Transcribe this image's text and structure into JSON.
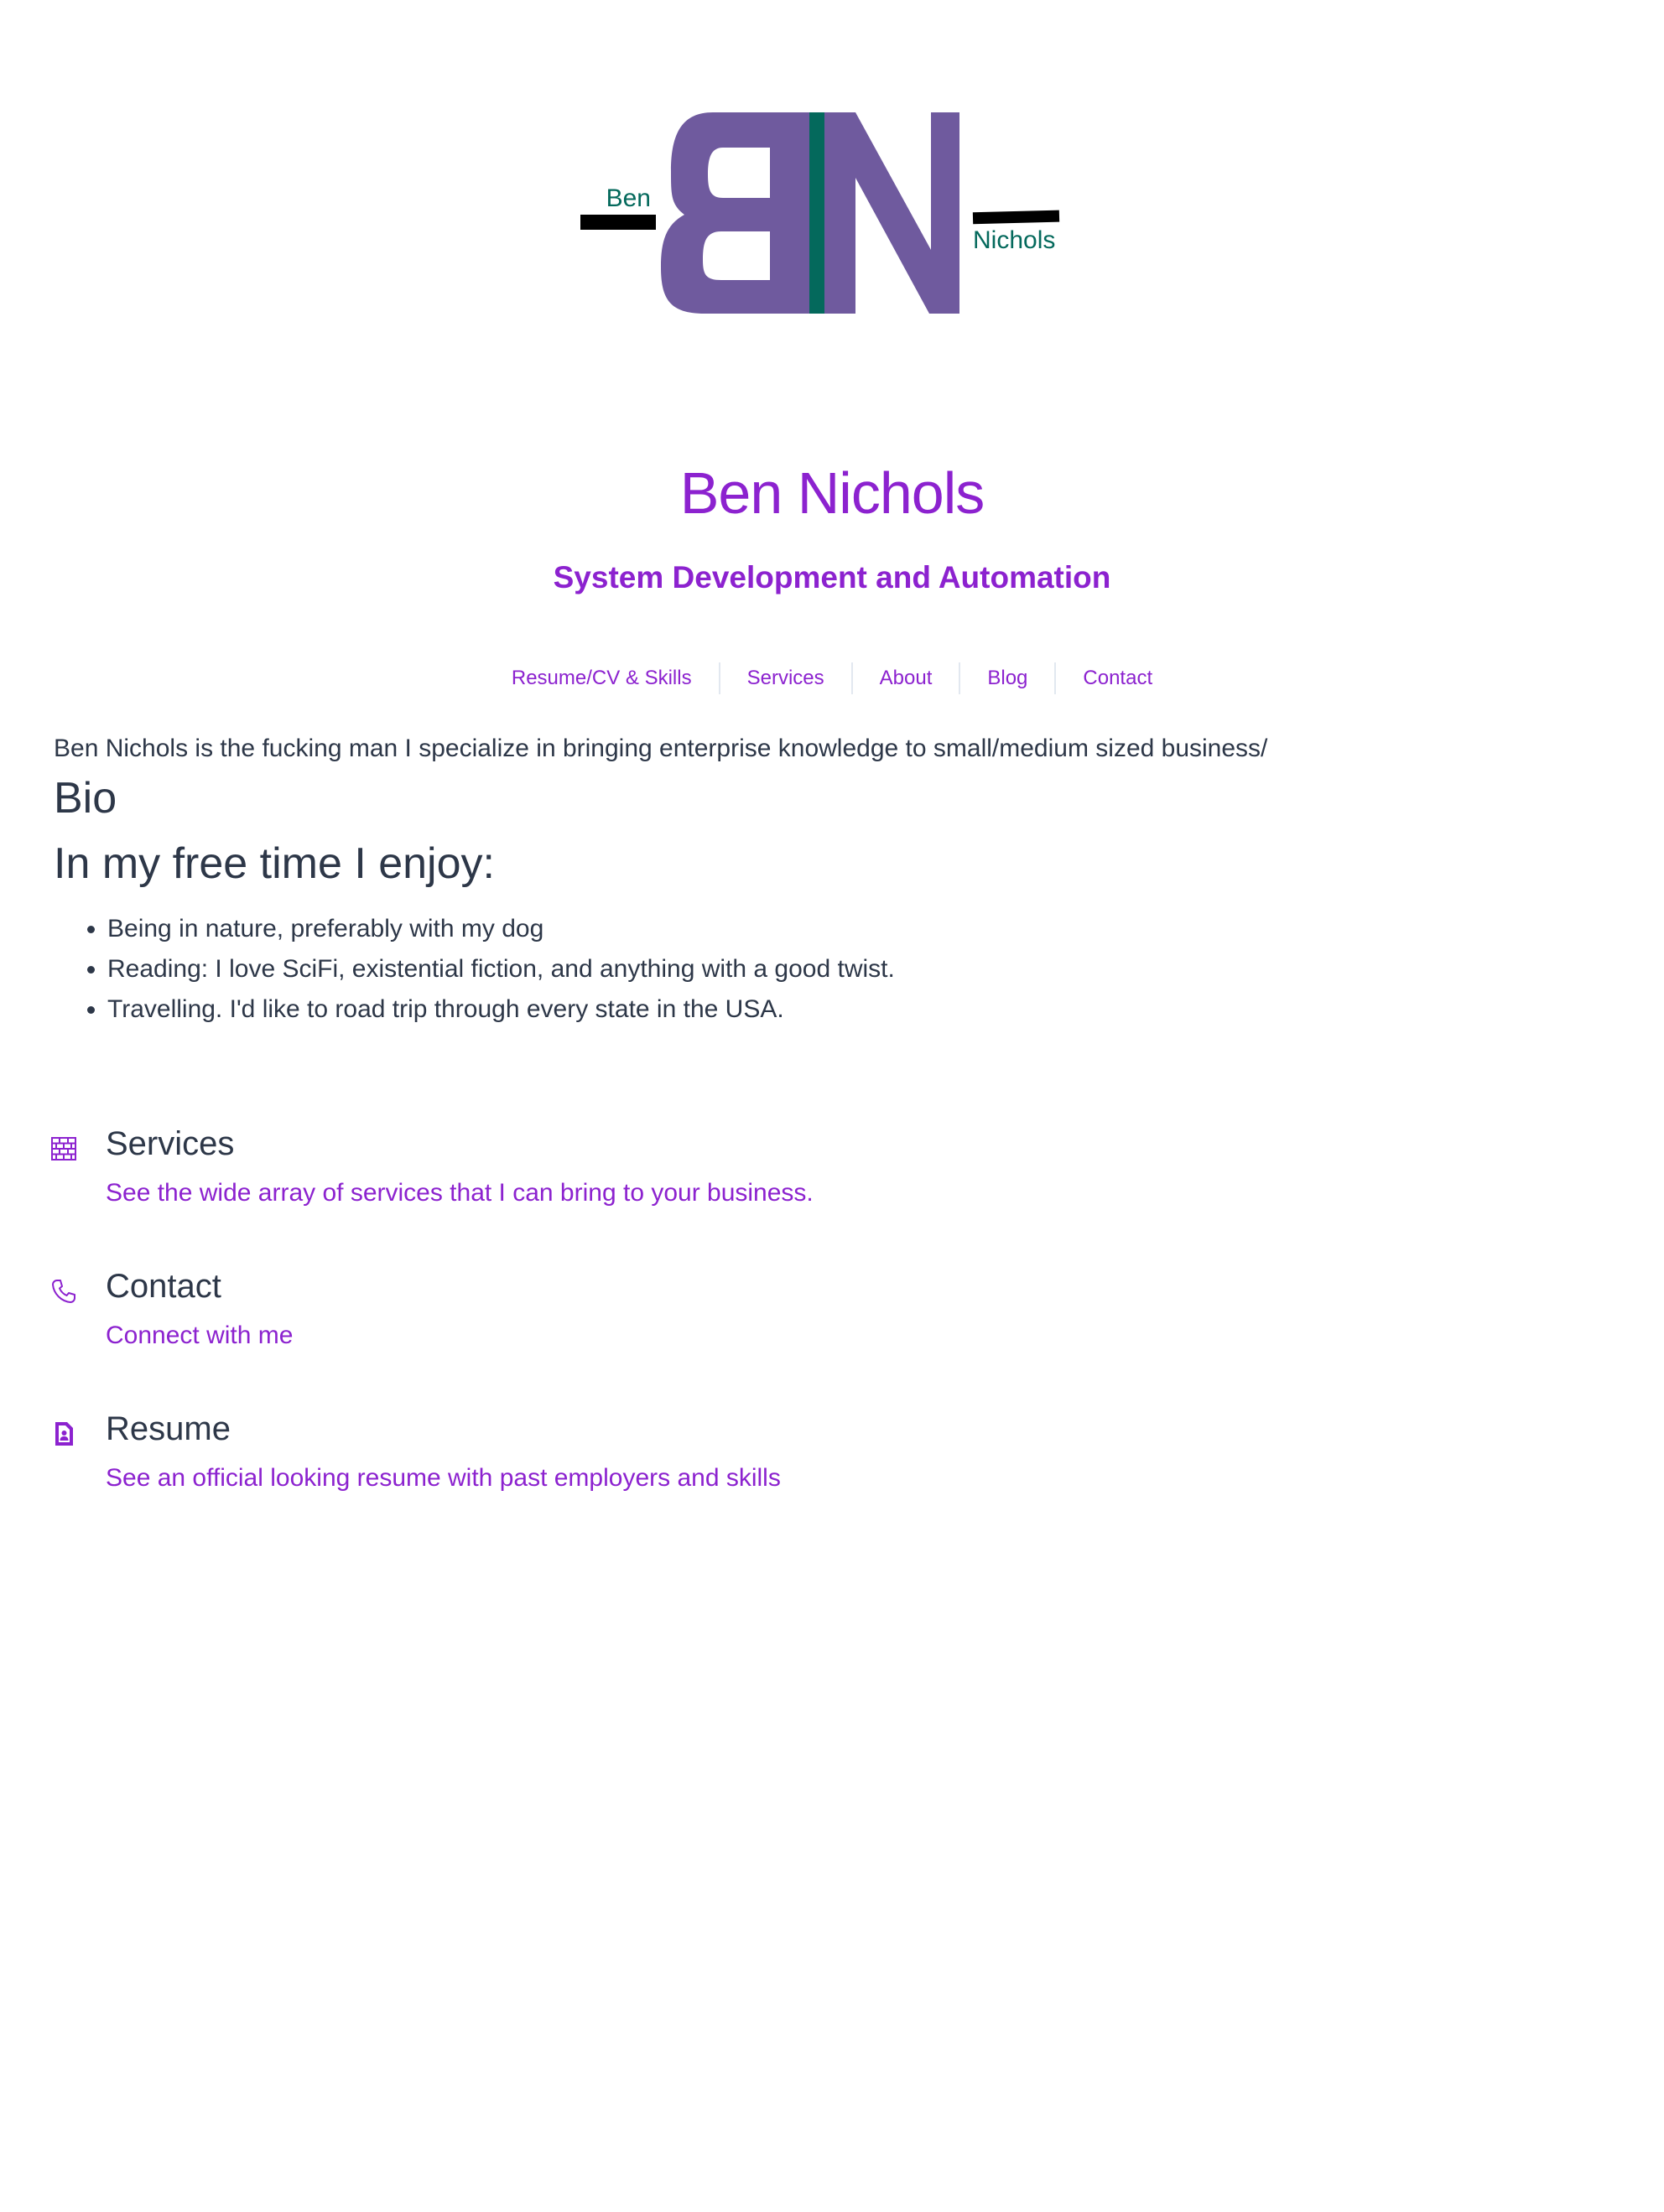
{
  "logo": {
    "first_name": "Ben",
    "last_name": "Nichols",
    "purple": "#6f5a9e",
    "teal": "#04695c",
    "bar": "#000000"
  },
  "header": {
    "title": "Ben Nichols",
    "subtitle": "System Development and Automation",
    "accent": "#8c22cf"
  },
  "nav": [
    {
      "label": "Resume/CV & Skills"
    },
    {
      "label": "Services"
    },
    {
      "label": "About"
    },
    {
      "label": "Blog"
    },
    {
      "label": "Contact"
    }
  ],
  "main": {
    "intro": "Ben Nichols is the fucking man I specialize in bringing enterprise knowledge to small/medium sized business/",
    "bio_heading": "Bio",
    "free_time_heading": "In my free time I enjoy:",
    "hobbies": [
      "Being in nature, preferably with my dog",
      "Reading: I love SciFi, existential fiction, and anything with a good twist.",
      "Travelling. I'd like to road trip through every state in the USA."
    ]
  },
  "cards": [
    {
      "title": "Services",
      "link": "See the wide array of services that I can bring to your business.",
      "icon": "brick-wall-icon"
    },
    {
      "title": "Contact",
      "link": "Connect with me",
      "icon": "phone-icon"
    },
    {
      "title": "Resume",
      "link": "See an official looking resume with past employers and skills",
      "icon": "resume-document-icon"
    }
  ],
  "colors": {
    "text": "#2d3748",
    "link": "#8c22cf",
    "divider": "#e2e8f0"
  }
}
